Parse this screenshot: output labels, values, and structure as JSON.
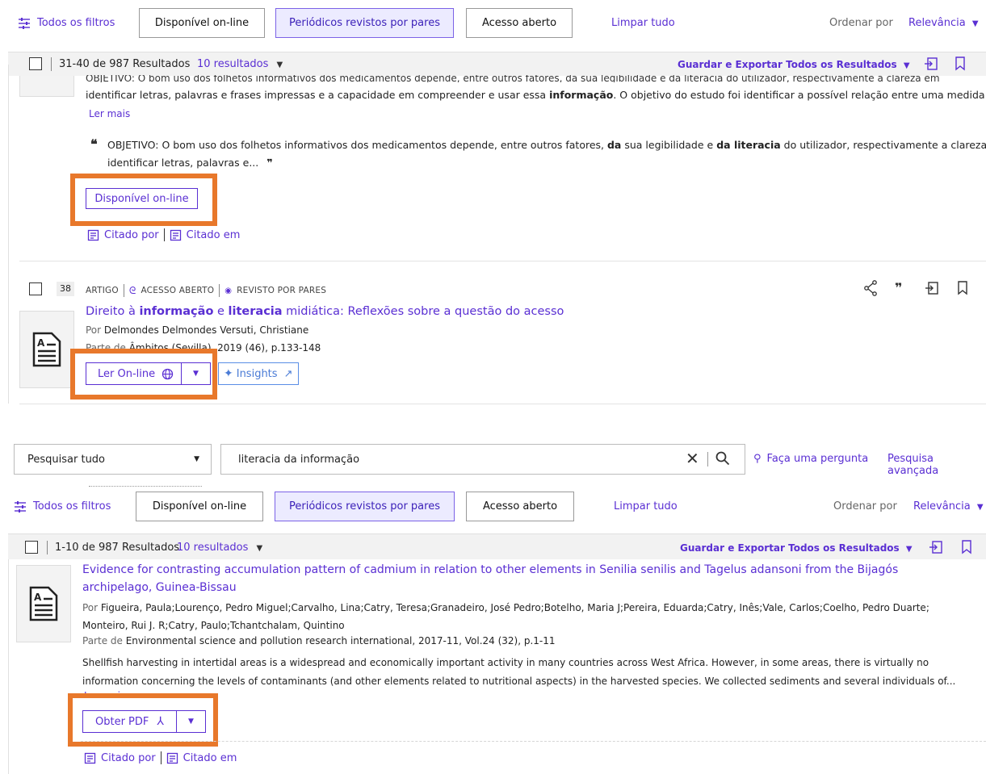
{
  "colors": {
    "accent": "#5a2fd3",
    "highlight": "#e8782b",
    "active_bg": "#ecebff"
  },
  "top": {
    "filters": {
      "all_filters": "Todos os filtros",
      "online": "Disponível on-line",
      "peer": "Periódicos revistos por pares",
      "open": "Acesso aberto",
      "clear": "Limpar tudo",
      "sort_label": "Ordenar por",
      "sort_value": "Relevância"
    },
    "results": {
      "range": "31-40 de 987 Resultados",
      "per_page": "10 resultados",
      "save_export": "Guardar e Exportar Todos os Resultados"
    },
    "item37": {
      "abstract_clip": "OBJETIVO: O bom uso dos folhetos informativos dos medicamentos depende, entre outros fatores, da sua legibilidade e da literacia do utilizador, respectivamente a clareza em",
      "abstract_l2_a": "identificar letras, palavras e frases impressas e a capacidade em compreender e usar essa ",
      "abstract_l2_b": "informação",
      "abstract_l2_c": ". O objetivo do estudo foi identificar a possível relação entre uma medida de...",
      "read_more": "Ler mais",
      "quote_a": "OBJETIVO: O bom uso dos folhetos informativos dos medicamentos depende, entre outros fatores, ",
      "quote_b": "da",
      "quote_c": " sua legibilidade e ",
      "quote_d": "da literacia",
      "quote_e": " do utilizador, respectivamente a clareza em",
      "quote_l2": "identificar letras, palavras e...",
      "online_btn": "Disponível on-line",
      "cited_by": "Citado por",
      "cited_in": "Citado em"
    },
    "item38": {
      "number": "38",
      "type": "ARTIGO",
      "open": "ACESSO ABERTO",
      "peer": "REVISTO POR PARES",
      "title_a": "Direito à ",
      "title_b": "informação",
      "title_c": " e ",
      "title_d": "literacia",
      "title_e": " midiática: Reflexões sobre a questão do acesso",
      "by_label": "Por",
      "authors": "Delmondes Delmondes Versuti, Christiane",
      "part_label": "Parte de",
      "source": "Âmbitos (Sevilla), 2019 (46), p.133-148",
      "read_online": "Ler On-line",
      "insights": "Insights"
    }
  },
  "search": {
    "scope": "Pesquisar tudo",
    "query": "literacia da informação",
    "ask": "Faça uma pergunta",
    "advanced": "Pesquisa avançada"
  },
  "bottom": {
    "filters": {
      "all_filters": "Todos os filtros",
      "online": "Disponível on-line",
      "peer": "Periódicos revistos por pares",
      "open": "Acesso aberto",
      "clear": "Limpar tudo",
      "sort_label": "Ordenar por",
      "sort_value": "Relevância"
    },
    "results": {
      "range": "1-10 de 987 Resultados",
      "per_page": "10 resultados",
      "save_export": "Guardar e Exportar Todos os Resultados"
    },
    "item1": {
      "title_l1": "Evidence for contrasting accumulation pattern of cadmium in relation to other elements in Senilia senilis and Tagelus adansoni from the Bijagós",
      "title_l2": "archipelago, Guinea-Bissau",
      "by_label": "Por",
      "authors_l1": "Figueira, Paula;Lourenço, Pedro Miguel;Carvalho, Lina;Catry, Teresa;Granadeiro, José Pedro;Botelho, Maria J;Pereira, Eduarda;Catry, Inês;Vale, Carlos;Coelho, Pedro Duarte;",
      "authors_l2": "Monteiro, Rui J. R;Catry, Paulo;Tchantchalam, Quintino",
      "part_label": "Parte de",
      "source": "Environmental science and pollution research international, 2017-11, Vol.24 (32), p.1-11",
      "abstract_l1": "Shellfish harvesting in intertidal areas is a widespread and economically important activity in many countries across West Africa. However, in some areas, there is virtually no",
      "abstract_l2": "information concerning the levels of contaminants (and other elements related to nutritional aspects) in the harvested species. We collected sediments and several individuals of...",
      "read_more": "Ler mais",
      "get_pdf": "Obter PDF",
      "cited_by": "Citado por",
      "cited_in": "Citado em"
    }
  }
}
